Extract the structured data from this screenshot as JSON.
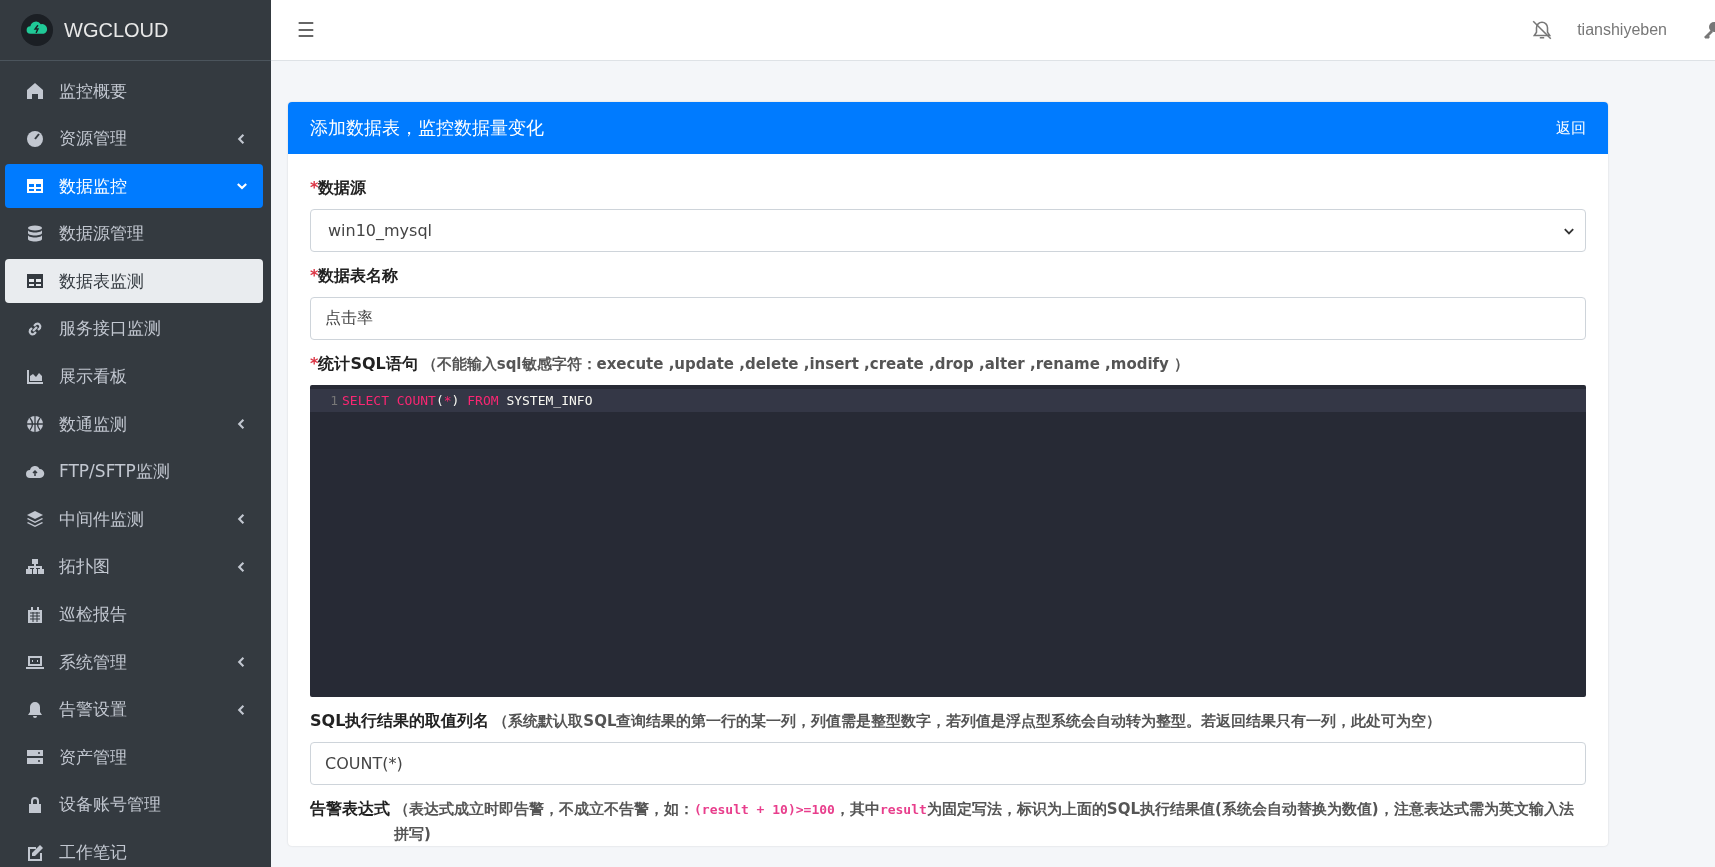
{
  "brand": {
    "name": "WGCLOUD"
  },
  "sidebar": {
    "items": [
      {
        "label": "监控概要",
        "submenu": false,
        "expanded": false,
        "active": false
      },
      {
        "label": "资源管理",
        "submenu": true,
        "expanded": false,
        "active": false
      },
      {
        "label": "数据监控",
        "submenu": true,
        "expanded": true,
        "active": true,
        "children": [
          {
            "label": "数据源管理",
            "selected": false
          },
          {
            "label": "数据表监测",
            "selected": true
          }
        ]
      },
      {
        "label": "服务接口监测",
        "submenu": false,
        "expanded": false,
        "active": false
      },
      {
        "label": "展示看板",
        "submenu": false,
        "expanded": false,
        "active": false
      },
      {
        "label": "数通监测",
        "submenu": true,
        "expanded": false,
        "active": false
      },
      {
        "label": "FTP/SFTP监测",
        "submenu": false,
        "expanded": false,
        "active": false
      },
      {
        "label": "中间件监测",
        "submenu": true,
        "expanded": false,
        "active": false
      },
      {
        "label": "拓扑图",
        "submenu": true,
        "expanded": false,
        "active": false
      },
      {
        "label": "巡检报告",
        "submenu": false,
        "expanded": false,
        "active": false
      },
      {
        "label": "系统管理",
        "submenu": true,
        "expanded": false,
        "active": false
      },
      {
        "label": "告警设置",
        "submenu": true,
        "expanded": false,
        "active": false
      },
      {
        "label": "资产管理",
        "submenu": false,
        "expanded": false,
        "active": false
      },
      {
        "label": "设备账号管理",
        "submenu": false,
        "expanded": false,
        "active": false
      },
      {
        "label": "工作笔记",
        "submenu": false,
        "expanded": false,
        "active": false
      }
    ]
  },
  "topbar": {
    "menu_glyph": "☰",
    "user": "tianshiyeben"
  },
  "card": {
    "title": "添加数据表，监控数据量变化",
    "back_link": "返回",
    "fields": [
      {
        "kind": "select",
        "required": true,
        "label": "数据源",
        "value": "win10_mysql"
      },
      {
        "kind": "text",
        "required": true,
        "label": "数据表名称",
        "value": "点击率"
      },
      {
        "kind": "code",
        "required": true,
        "label": "统计SQL语句",
        "hint": "（不能输入sql敏感字符：execute ,update ,delete ,insert ,create ,drop ,alter ,rename ,modify ）",
        "lines": [
          {
            "number": "1",
            "tokens": [
              {
                "kind": "keyword",
                "text": "SELECT"
              },
              {
                "kind": "keyword",
                "text": " COUNT"
              },
              {
                "kind": "plain",
                "text": "("
              },
              {
                "kind": "keyword",
                "text": "*"
              },
              {
                "kind": "plain",
                "text": ") "
              },
              {
                "kind": "keyword",
                "text": "FROM"
              },
              {
                "kind": "plain",
                "text": " SYSTEM_INFO"
              }
            ]
          }
        ]
      },
      {
        "kind": "text",
        "required": false,
        "label": "SQL执行结果的取值列名",
        "hint": "（系统默认取SQL查询结果的第一行的某一列，列值需是整型数字，若列值是浮点型系统会自动转为整型。若返回结果只有一列，此处可为空）",
        "value": "COUNT(*)"
      },
      {
        "kind": "note",
        "required": false,
        "label": "告警表达式",
        "hint_parts": [
          {
            "kind": "text",
            "text": "（表达式成立时即告警，不成立不告警，如："
          },
          {
            "kind": "code",
            "text": "(result + 10)>=100"
          },
          {
            "kind": "text",
            "text": "，其中"
          },
          {
            "kind": "code",
            "text": "result"
          },
          {
            "kind": "text",
            "text": "为固定写法，标识为上面的SQL执行结果值(系统会自动替换为数值)，注意表达式需为英文输入法拼写)"
          }
        ]
      }
    ]
  }
}
